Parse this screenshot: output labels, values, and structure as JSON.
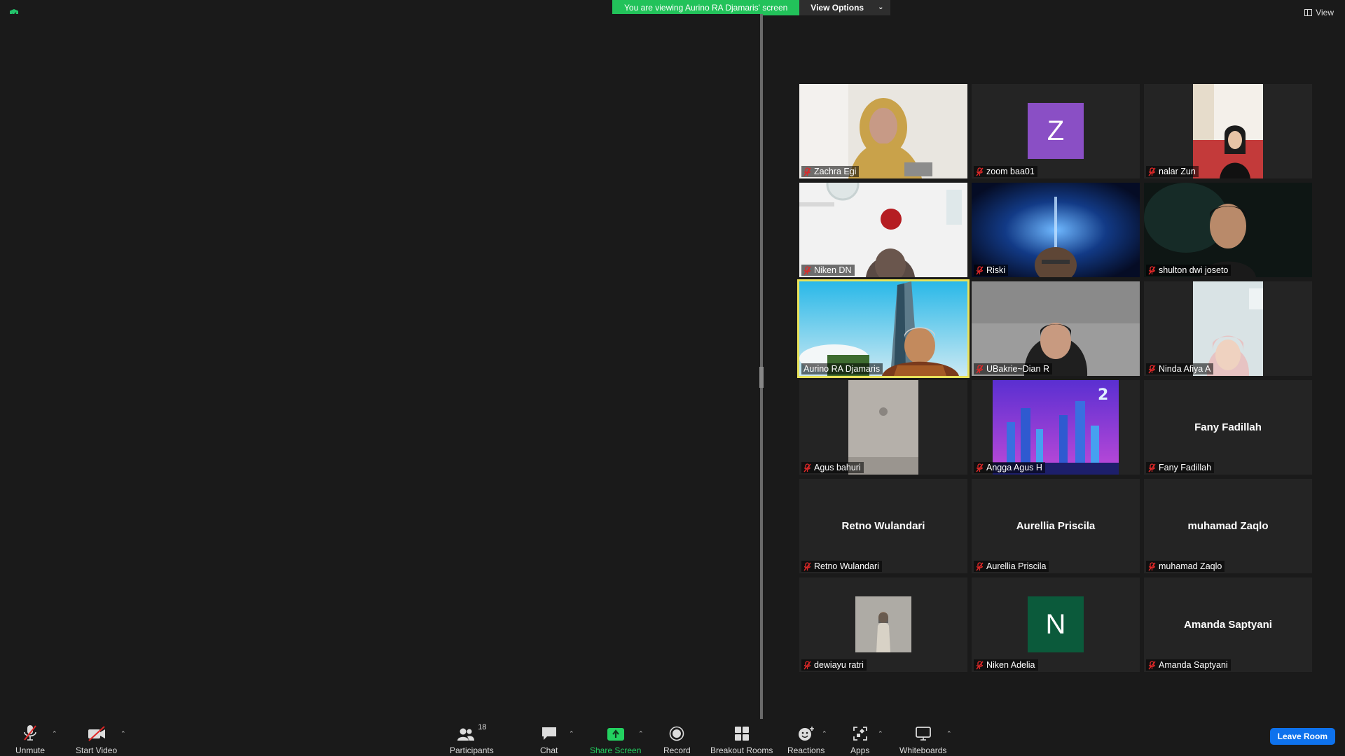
{
  "banner": {
    "viewing_text": "You are viewing Aurino RA Djamaris' screen",
    "view_options_label": "View Options"
  },
  "view_label": "View",
  "participants": [
    {
      "name": "Zachra Egi",
      "type": "video",
      "muted": true
    },
    {
      "name": "zoom baa01",
      "type": "avatar",
      "initial": "Z",
      "avatar_color": "#8a4fc5",
      "muted": true
    },
    {
      "name": "nalar Zun",
      "type": "video",
      "muted": true
    },
    {
      "name": "Niken DN",
      "type": "video",
      "muted": true
    },
    {
      "name": "Riski",
      "type": "video",
      "muted": true
    },
    {
      "name": "shulton dwi joseto",
      "type": "video",
      "muted": true
    },
    {
      "name": "Aurino RA Djamaris",
      "type": "video",
      "muted": false,
      "active_speaker": true
    },
    {
      "name": "UBakrie~Dian R",
      "type": "video",
      "muted": true
    },
    {
      "name": "Ninda Afiya A",
      "type": "video",
      "muted": true
    },
    {
      "name": "Agus bahuri",
      "type": "video",
      "muted": true
    },
    {
      "name": "Angga Agus H",
      "type": "video",
      "muted": true
    },
    {
      "name": "Fany Fadillah",
      "type": "name",
      "muted": true
    },
    {
      "name": "Retno Wulandari",
      "type": "name",
      "muted": true
    },
    {
      "name": "Aurellia Priscila",
      "type": "name",
      "muted": true
    },
    {
      "name": "muhamad Zaqlo",
      "type": "name",
      "muted": true
    },
    {
      "name": "dewiayu ratri",
      "type": "photo",
      "muted": true
    },
    {
      "name": "Niken Adelia",
      "type": "avatar",
      "initial": "N",
      "avatar_color": "#0b5a3b",
      "muted": true
    },
    {
      "name": "Amanda Saptyani",
      "type": "name",
      "muted": true
    }
  ],
  "toolbar": {
    "unmute": "Unmute",
    "start_video": "Start Video",
    "participants": "Participants",
    "participants_count": "18",
    "chat": "Chat",
    "share_screen": "Share Screen",
    "record": "Record",
    "breakout_rooms": "Breakout Rooms",
    "reactions": "Reactions",
    "apps": "Apps",
    "whiteboards": "Whiteboards",
    "leave_room": "Leave Room"
  },
  "colors": {
    "banner_green": "#22c25a",
    "active_speaker_border": "#e8e25a",
    "leave_blue": "#0e72ed",
    "muted_red": "#e02828",
    "share_green": "#23d160"
  }
}
